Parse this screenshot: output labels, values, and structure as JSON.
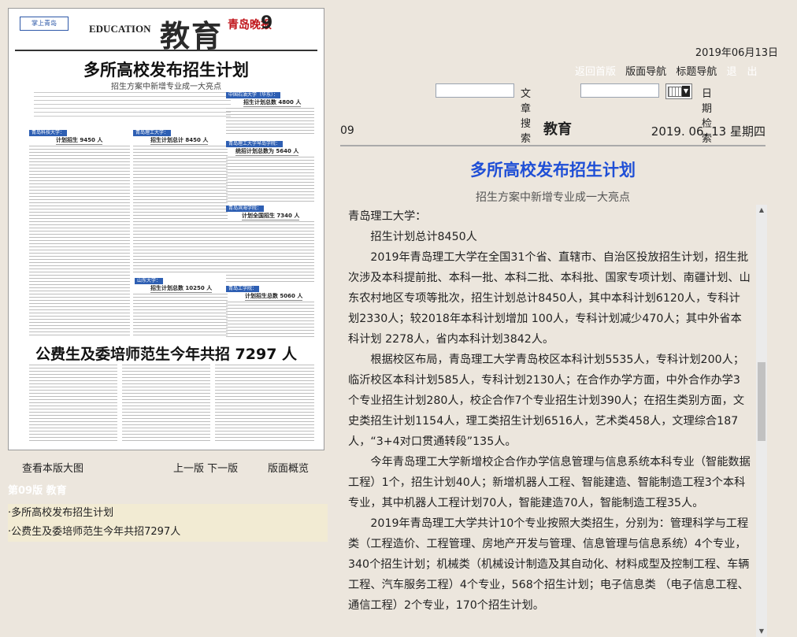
{
  "newspaper_thumb": {
    "logo": "掌上青岛",
    "edu_en": "EDUCATION",
    "edu_cn": "教育",
    "paper_name": "青岛晚报",
    "page_no": "9",
    "headline1": "多所高校发布招生计划",
    "sub1": "招生方案中新增专业成一大亮点",
    "headline2": "公费生及委培师范生今年共招 7297 人",
    "boxes": [
      "计划招生 9450 人",
      "招生计划总计 8450 人",
      "招生计划总数 4800 人",
      "统招计划总数为 5640 人",
      "计划全国招生 7340 人",
      "招生计划总数 10250 人",
      "计划招生总数 5060 人"
    ],
    "tags": [
      "青岛科技大学：",
      "青岛理工大学：",
      "中国石油大学（华东）：",
      "青岛理工大学琴岛学院：",
      "青岛滨海学院：",
      "山东大学：",
      "青岛工学院："
    ]
  },
  "left_links": {
    "view_large": "查看本版大图",
    "prev_next": "上一版 下一版",
    "overview": "版面概览"
  },
  "section_head": "第09版 教育",
  "articles": [
    "·多所高校发布招生计划",
    "·公费生及委培师范生今年共招7297人"
  ],
  "date_top": "2019年06月13日",
  "nav": {
    "home": "返回首版",
    "page_nav": "版面导航",
    "title_nav": "标题导航",
    "exit": "退　出"
  },
  "search": {
    "article_label": "文章搜索",
    "date_label": "日期检索"
  },
  "page_bar": {
    "page_number": "09",
    "title": "教育",
    "date": "2019. 06. 13  星期四"
  },
  "article": {
    "title": "多所高校发布招生计划",
    "subtitle": "招生方案中新增专业成一大亮点",
    "paragraphs": [
      "青岛理工大学：",
      "招生计划总计8450人",
      "2019年青岛理工大学在全国31个省、直辖市、自治区投放招生计划，招生批次涉及本科提前批、本科一批、本科二批、本科批、国家专项计划、南疆计划、山东农村地区专项等批次，招生计划总计8450人，其中本科计划6120人，专科计划2330人；较2018年本科计划增加 100人，专科计划减少470人；其中外省本科计划 2278人，省内本科计划3842人。",
      "根据校区布局，青岛理工大学青岛校区本科计划5535人，专科计划200人；临沂校区本科计划585人，专科计划2130人；在合作办学方面，中外合作办学3个专业招生计划280人，校企合作7个专业招生计划390人；在招生类别方面，文史类招生计划1154人，理工类招生计划6516人，艺术类458人，文理综合187人，“3+4对口贯通转段”135人。",
      "今年青岛理工大学新增校企合作办学信息管理与信息系统本科专业（智能数据工程）1个，招生计划40人；新增机器人工程、智能建造、智能制造工程3个本科专业，其中机器人工程计划70人，智能建造70人，智能制造工程35人。",
      "2019年青岛理工大学共计10个专业按照大类招生，分别为：管理科学与工程类（工程造价、工程管理、房地产开发与管理、信息管理与信息系统）4个专业，340个招生计划；机械类（机械设计制造及其自动化、材料成型及控制工程、车辆工程、汽车服务工程）4个专业，568个招生计划；电子信息类 （电子信息工程、通信工程）2个专业，170个招生计划。"
    ]
  }
}
